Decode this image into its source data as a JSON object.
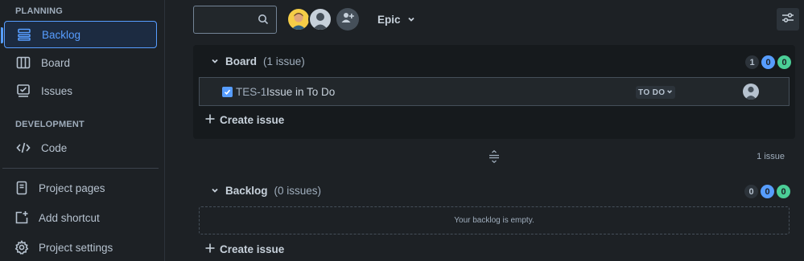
{
  "sidebar": {
    "planning_heading": "PLANNING",
    "development_heading": "DEVELOPMENT",
    "items": [
      {
        "label": "Backlog",
        "icon": "backlog-icon"
      },
      {
        "label": "Board",
        "icon": "board-icon"
      },
      {
        "label": "Issues",
        "icon": "issues-icon"
      },
      {
        "label": "Code",
        "icon": "code-icon"
      }
    ],
    "bottom_items": [
      {
        "label": "Project pages",
        "icon": "page-icon"
      },
      {
        "label": "Add shortcut",
        "icon": "add-shortcut-icon"
      },
      {
        "label": "Project settings",
        "icon": "gear-icon"
      }
    ]
  },
  "toolbar": {
    "search_placeholder": "",
    "epic_label": "Epic"
  },
  "board_section": {
    "name": "Board",
    "count": "(1 issue)",
    "lozenges": [
      "1",
      "0",
      "0"
    ],
    "issue": {
      "key": "TES-1",
      "summary": "Issue in To Do",
      "status": "TO DO"
    },
    "create_label": "Create issue"
  },
  "issue_total": "1 issue",
  "backlog_section": {
    "name": "Backlog",
    "count": "(0 issues)",
    "lozenges": [
      "0",
      "0",
      "0"
    ],
    "empty_text": "Your backlog is empty.",
    "create_label": "Create issue"
  },
  "colors": {
    "background": "#1d2125",
    "accent": "#579dff",
    "done_green": "#4bce97"
  }
}
